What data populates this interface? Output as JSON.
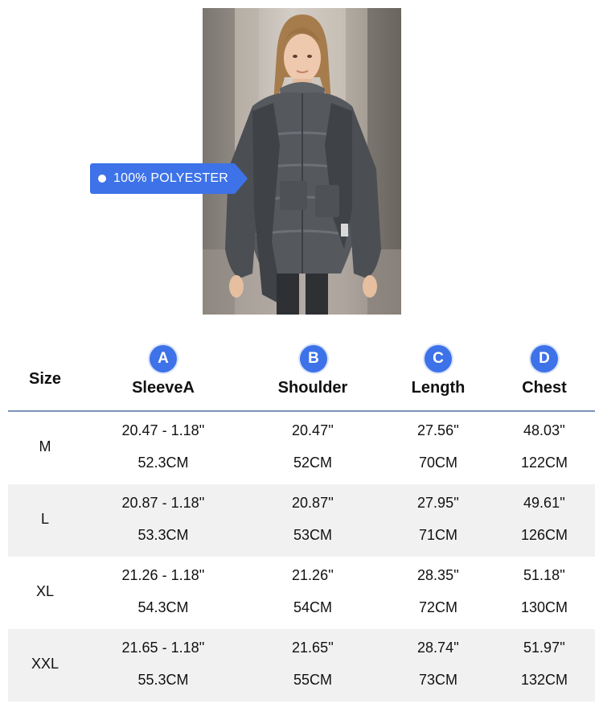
{
  "callout": {
    "text": "100% POLYESTER"
  },
  "table": {
    "size_header": "Size",
    "columns": [
      {
        "badge": "A",
        "label": "SleeveA"
      },
      {
        "badge": "B",
        "label": "Shoulder"
      },
      {
        "badge": "C",
        "label": "Length"
      },
      {
        "badge": "D",
        "label": "Chest"
      }
    ],
    "rows": [
      {
        "size": "M",
        "inch": [
          "20.47 - 1.18''",
          "20.47''",
          "27.56''",
          "48.03''"
        ],
        "cm": [
          "52.3CM",
          "52CM",
          "70CM",
          "122CM"
        ]
      },
      {
        "size": "L",
        "inch": [
          "20.87 - 1.18''",
          "20.87''",
          "27.95''",
          "49.61''"
        ],
        "cm": [
          "53.3CM",
          "53CM",
          "71CM",
          "126CM"
        ]
      },
      {
        "size": "XL",
        "inch": [
          "21.26 - 1.18''",
          "21.26''",
          "28.35''",
          "51.18''"
        ],
        "cm": [
          "54.3CM",
          "54CM",
          "72CM",
          "130CM"
        ]
      },
      {
        "size": "XXL",
        "inch": [
          "21.65 - 1.18''",
          "21.65''",
          "28.74''",
          "51.97''"
        ],
        "cm": [
          "55.3CM",
          "55CM",
          "73CM",
          "132CM"
        ]
      }
    ]
  },
  "colors": {
    "accent": "#3d72e8",
    "row_alt": "#f1f1f1",
    "header_rule": "#7a93b8"
  }
}
